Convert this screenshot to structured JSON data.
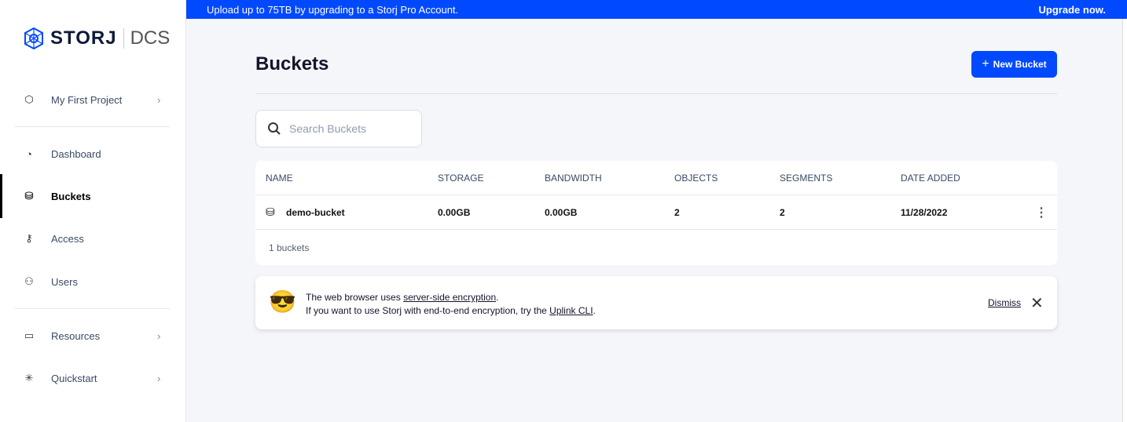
{
  "banner": {
    "text": "Upload up to 75TB by upgrading to a Storj Pro Account.",
    "cta": "Upgrade now."
  },
  "logo": {
    "name": "STORJ",
    "product": "DCS"
  },
  "sidebar": {
    "project": "My First Project",
    "items": [
      {
        "label": "Dashboard"
      },
      {
        "label": "Buckets"
      },
      {
        "label": "Access"
      },
      {
        "label": "Users"
      },
      {
        "label": "Resources"
      },
      {
        "label": "Quickstart"
      }
    ]
  },
  "page": {
    "title": "Buckets",
    "new_button": "New Bucket",
    "search_placeholder": "Search Buckets"
  },
  "table": {
    "headers": [
      "NAME",
      "STORAGE",
      "BANDWIDTH",
      "OBJECTS",
      "SEGMENTS",
      "DATE ADDED"
    ],
    "rows": [
      {
        "name": "demo-bucket",
        "storage": "0.00GB",
        "bandwidth": "0.00GB",
        "objects": "2",
        "segments": "2",
        "date": "11/28/2022"
      }
    ],
    "footer": "1 buckets"
  },
  "notice": {
    "line1_pre": "The web browser uses ",
    "line1_link": "server-side encryption",
    "line1_post": ".",
    "line2_pre": "If you want to use Storj with end-to-end encryption, try the ",
    "line2_link": "Uplink CLI",
    "line2_post": ".",
    "dismiss": "Dismiss"
  },
  "colors": {
    "accent": "#0149ff"
  }
}
